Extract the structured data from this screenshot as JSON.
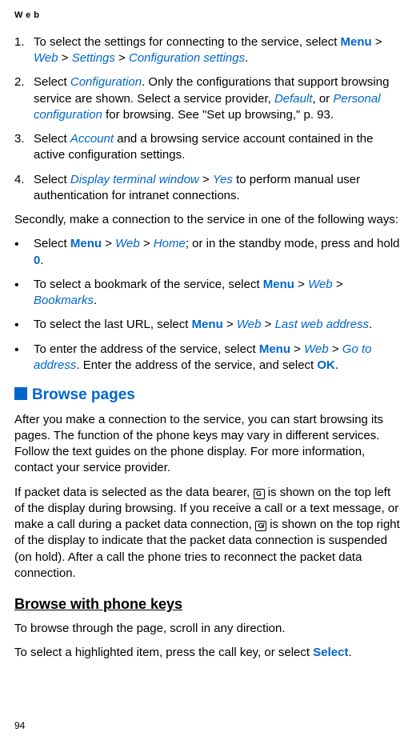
{
  "header": "Web",
  "ol": [
    {
      "num": "1.",
      "pre": "To select the settings for connecting to the service, select ",
      "menu": "Menu",
      "gt1": " > ",
      "web": "Web",
      "gt2": " > ",
      "settings": "Settings",
      "gt3": " > ",
      "config": "Configuration settings",
      "post": "."
    },
    {
      "num": "2.",
      "pre": "Select ",
      "configuration": "Configuration",
      "mid1": ". Only the configurations that support browsing service are shown. Select a service provider, ",
      "default": "Default",
      "mid2": ", or ",
      "personal": "Personal configuration",
      "post": " for browsing. See \"Set up browsing,\" p. 93."
    },
    {
      "num": "3.",
      "pre": "Select ",
      "account": "Account",
      "post": " and a browsing service account contained in the active configuration settings."
    },
    {
      "num": "4.",
      "pre": "Select ",
      "display": "Display terminal window",
      "gt": " > ",
      "yes": "Yes",
      "post": " to perform manual user authentication for intranet connections."
    }
  ],
  "para1": "Secondly, make a connection to the service in one of the following ways:",
  "ul": [
    {
      "pre": "Select ",
      "menu": "Menu",
      "gt1": " > ",
      "web": "Web",
      "gt2": " > ",
      "home": "Home",
      "mid": "; or in the standby mode, press and hold ",
      "zero": "0",
      "post": "."
    },
    {
      "pre": "To select a bookmark of the service, select ",
      "menu": "Menu",
      "gt1": " > ",
      "web": "Web",
      "gt2": " > ",
      "bookmarks": "Bookmarks",
      "post": "."
    },
    {
      "pre": "To select the last URL, select ",
      "menu": "Menu",
      "gt1": " > ",
      "web": "Web",
      "gt2": " > ",
      "last": "Last web address",
      "post": "."
    },
    {
      "pre": "To enter the address of the service, select ",
      "menu": "Menu",
      "gt1": " > ",
      "web": "Web",
      "gt2": " > ",
      "goto": "Go to address",
      "mid": ". Enter the address of the service, and select ",
      "ok": "OK",
      "post": "."
    }
  ],
  "section": {
    "title": "Browse pages",
    "p1": "After you make a connection to the service, you can start browsing its pages. The function of the phone keys may vary in different services. Follow the text guides on the phone display. For more information, contact your service provider.",
    "p2a": "If packet data is selected as the data bearer, ",
    "icon1": "G",
    "p2b": " is shown on the top left of the display during browsing. If you receive a call or a text message, or make a call during a packet data connection, ",
    "icon2": "G̸",
    "p2c": " is shown on the top right of the display to indicate that the packet data connection is suspended (on hold). After a call the phone tries to reconnect the packet data connection."
  },
  "subsection": {
    "title": "Browse with phone keys",
    "p1": "To browse through the page, scroll in any direction.",
    "p2a": "To select a highlighted item, press the call key, or select ",
    "select": "Select",
    "p2b": "."
  },
  "pageNum": "94"
}
